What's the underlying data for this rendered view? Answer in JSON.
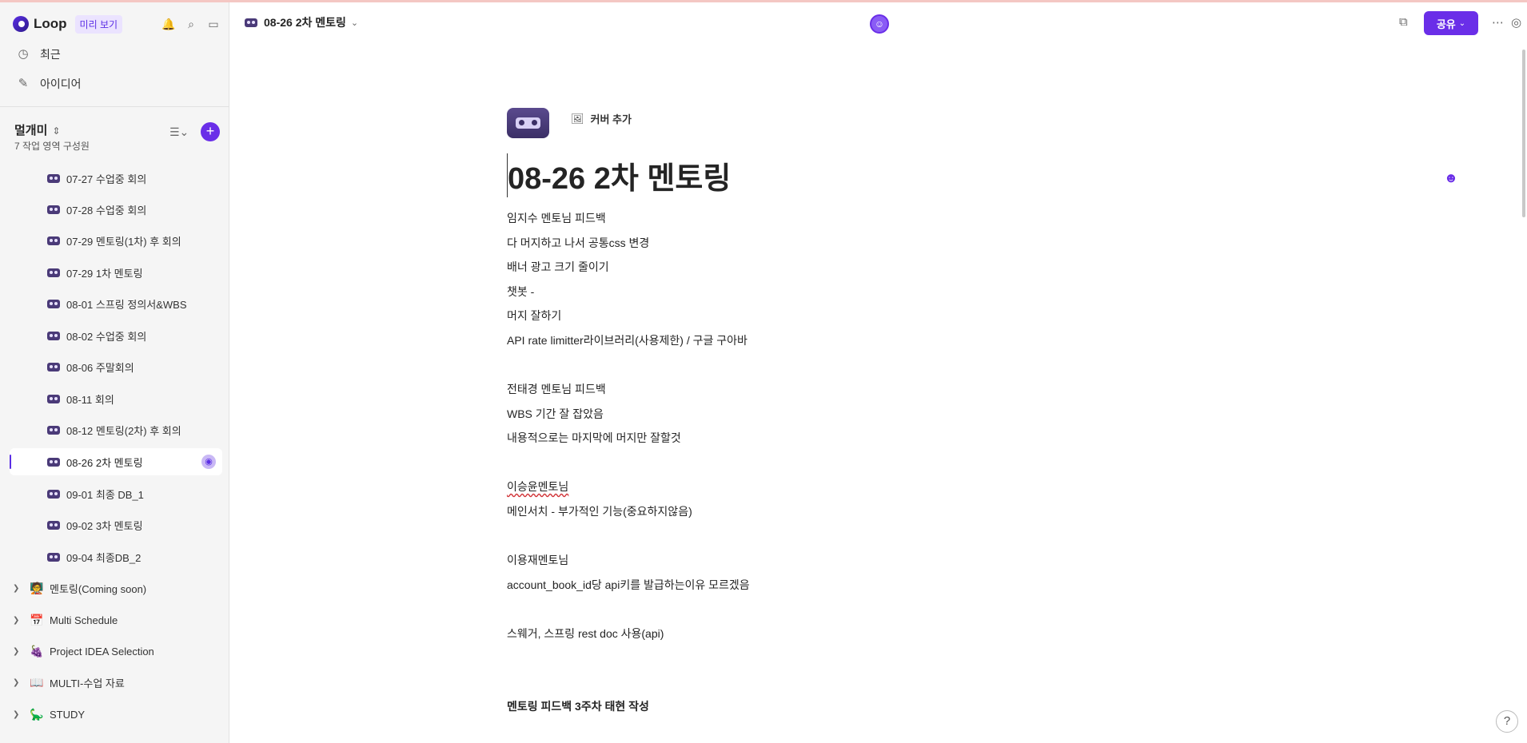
{
  "app": {
    "logo": "Loop",
    "preview_badge": "미리 보기"
  },
  "sidebar": {
    "icons": [
      "bell-icon",
      "search-icon",
      "panel-icon"
    ],
    "nav": [
      {
        "label": "최근",
        "icon": "clock-icon"
      },
      {
        "label": "아이디어",
        "icon": "pen-icon"
      }
    ],
    "workspace": {
      "title": "멀개미",
      "subtitle": "7 작업 영역 구성원"
    },
    "pages": [
      {
        "label": "07-27 수업중 회의"
      },
      {
        "label": "07-28 수업중 회의"
      },
      {
        "label": "07-29 멘토링(1차) 후 회의"
      },
      {
        "label": "07-29 1차 멘토링"
      },
      {
        "label": "08-01 스프링 정의서&WBS"
      },
      {
        "label": "08-02 수업중 회의"
      },
      {
        "label": "08-06 주말회의"
      },
      {
        "label": "08-11 회의"
      },
      {
        "label": "08-12 멘토링(2차) 후 회의"
      },
      {
        "label": "08-26 2차 멘토링",
        "active": true
      },
      {
        "label": "09-01 최종 DB_1"
      },
      {
        "label": "09-02 3차 멘토링"
      },
      {
        "label": "09-04 최종DB_2"
      }
    ],
    "folders": [
      {
        "label": "멘토링(Coming soon)",
        "icon": "person-emoji-icon",
        "glyph": "🧑‍🏫"
      },
      {
        "label": "Multi Schedule",
        "icon": "calendar-icon",
        "glyph": "📅"
      },
      {
        "label": "Project IDEA Selection",
        "icon": "grapes-icon",
        "glyph": "🍇"
      },
      {
        "label": "MULTI-수업 자료",
        "icon": "book-icon",
        "glyph": "📖"
      },
      {
        "label": "STUDY",
        "icon": "dinosaur-icon",
        "glyph": "🦕"
      }
    ]
  },
  "header": {
    "doc_tab": "08-26 2차 멘토링",
    "share_label": "공유"
  },
  "document": {
    "add_cover": "커버 추가",
    "title": "08-26 2차 멘토링",
    "lines": [
      "임지수 멘토님 피드백",
      "다 머지하고 나서 공통css 변경",
      "배너 광고 크기 줄이기",
      "챗봇 -",
      "머지 잘하기",
      "API rate limitter라이브러리(사용제한) / 구글 구아바",
      "",
      "전태경 멘토님 피드백",
      "WBS 기간  잘 잡았음",
      "내용적으로는 마지막에 머지만 잘할것",
      "",
      "이승윤멘토님",
      "메인서치 - 부가적인 기능(중요하지않음)",
      "",
      "이용재멘토님",
      "account_book_id당 api키를 발급하는이유 모르겠음",
      "",
      "스웨거, 스프링 rest doc 사용(api)",
      "",
      "",
      "멘토링 피드백 3주차 태현 작성"
    ]
  },
  "colors": {
    "accent": "#6a2ee8",
    "sidebar_bg": "#f5f5f5"
  }
}
